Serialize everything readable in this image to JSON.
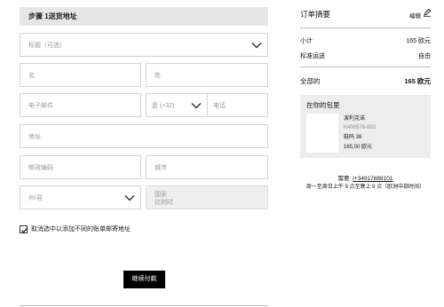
{
  "checkout": {
    "step_title": "步骤 1送货地址",
    "fields": {
      "title_placeholder": "标题（可选）",
      "first_name_placeholder": "名",
      "last_name_placeholder": "姓",
      "email_placeholder": "电子邮件",
      "country_code": "是 (+32)",
      "phone_placeholder": "电话",
      "address_placeholder": "地址",
      "postcode_placeholder": "邮政编码",
      "city_placeholder": "城市",
      "province_placeholder": "州/县",
      "country_label": "国家",
      "country_value": "比利时"
    },
    "checkbox_label": "取消选中以添加不同的账单邮寄地址",
    "checkbox_checked": true,
    "continue_label": "继续付款"
  },
  "summary": {
    "title": "订单摘要",
    "edit_label": "编辑",
    "subtotal_label": "小计",
    "subtotal_value": "165 欧元",
    "shipping_label": "标准运送",
    "shipping_value": "自由",
    "total_label": "全部的",
    "total_value": "165 欧元",
    "bag_title": "在你的包里",
    "product": {
      "name": "波利克诺",
      "sku": "K400578-002",
      "size": "鞋码 36",
      "price": "165,00 欧元"
    },
    "help_prefix": "需要: ",
    "help_phone": "/+34917888101",
    "help_hours": "周一至周日上午 9 点至晚上 9 点（欧洲中部时间）"
  },
  "icons": {
    "chevron": "chevron-down-icon",
    "edit": "pencil-icon",
    "check": "check-icon"
  }
}
